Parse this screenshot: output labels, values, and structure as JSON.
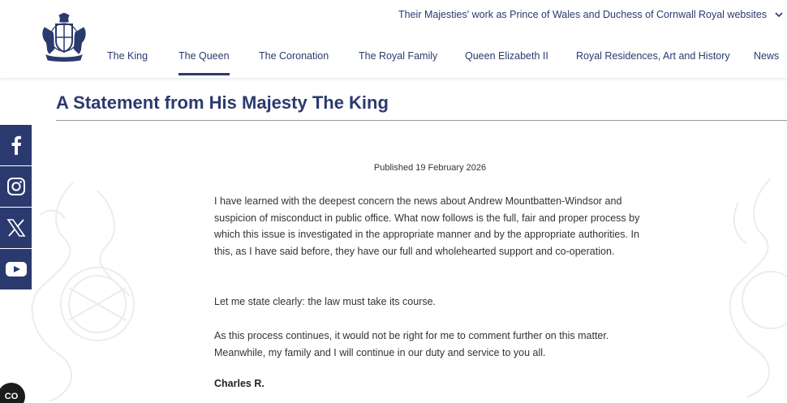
{
  "header": {
    "utility_links": [
      {
        "label": "Their Majesties' work as Prince of Wales and Duchess of Cornwall"
      },
      {
        "label": "Royal websites"
      }
    ],
    "nav": [
      {
        "label": "The King"
      },
      {
        "label": "The Queen",
        "active": true
      },
      {
        "label": "The Coronation"
      },
      {
        "label": "The Royal Family"
      },
      {
        "label": "Queen Elizabeth II"
      },
      {
        "label": "Royal Residences, Art and History"
      },
      {
        "label": "News"
      }
    ]
  },
  "social": [
    "facebook-icon",
    "instagram-icon",
    "x-icon",
    "youtube-icon"
  ],
  "article": {
    "title": "A Statement from His Majesty The King",
    "published": "Published 19 February 2026",
    "paragraphs": [
      "I have learned with the deepest concern the news about Andrew Mountbatten-Windsor and suspicion of misconduct in public office. What now follows is the full, fair and proper process by which this issue is investigated in the appropriate manner and by the appropriate authorities. In this, as I have said before, they have our full and wholehearted support and co-operation.",
      "Let me state clearly: the law must take its course.",
      "As this process continues, it would not be right for me to comment further on this matter. Meanwhile, my family and I will continue in our duty and service to you all."
    ],
    "signature": "Charles R."
  },
  "cookie_badge": {
    "label": "CO"
  },
  "colors": {
    "brand": "#2b3a6e",
    "rule": "#999999",
    "text": "#333333"
  }
}
